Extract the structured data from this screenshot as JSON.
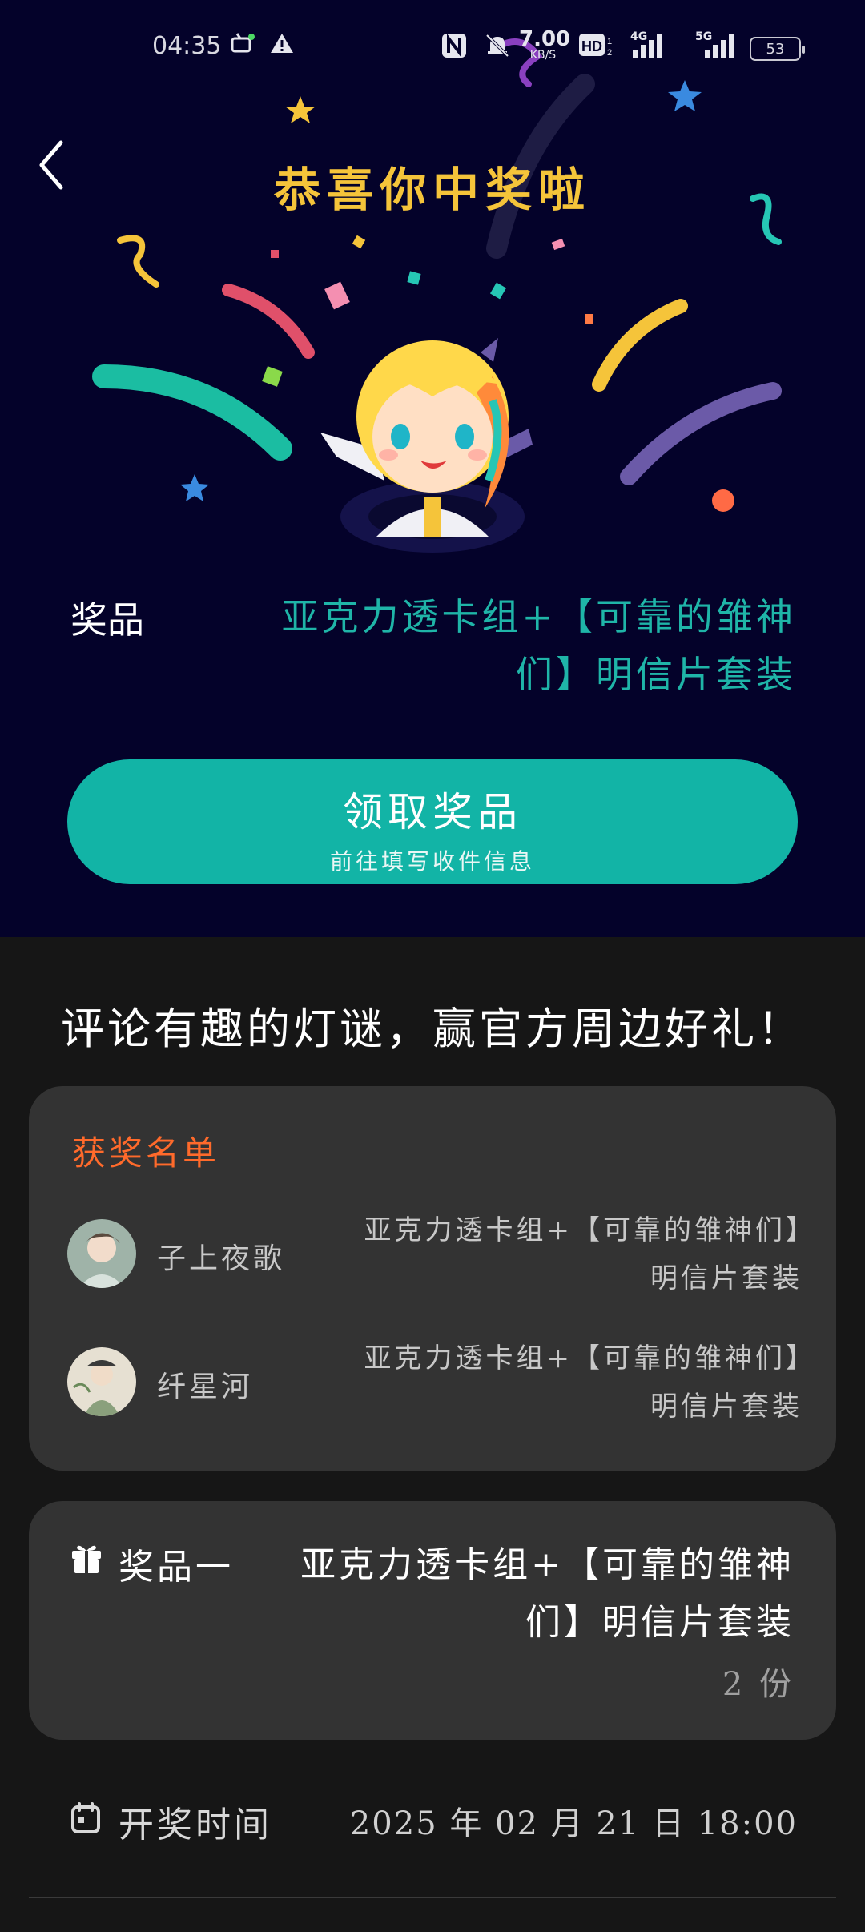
{
  "status_bar": {
    "time": "04:35",
    "speed_value": "7.00",
    "speed_unit": "KB/S",
    "network_1": "4G",
    "network_2": "5G",
    "battery": "53"
  },
  "banner": {
    "title": "恭喜你中奖啦",
    "prize_label": "奖品",
    "prize_name": "亚克力透卡组+【可靠的雏神们】明信片套装",
    "claim_button": {
      "label": "领取奖品",
      "sublabel": "前往填写收件信息"
    }
  },
  "event_title": "评论有趣的灯谜，赢官方周边好礼！",
  "winners": {
    "title": "获奖名单",
    "items": [
      {
        "name": "子上夜歌",
        "prize": "亚克力透卡组+【可靠的雏神们】明信片套装"
      },
      {
        "name": "纤星河",
        "prize": "亚克力透卡组+【可靠的雏神们】明信片套装"
      }
    ]
  },
  "prize_info": {
    "label": "奖品一",
    "name": "亚克力透卡组+【可靠的雏神们】明信片套装",
    "quantity": "2 份"
  },
  "draw": {
    "label": "开奖时间",
    "time": "2025 年 02 月 21 日 18:00"
  },
  "colors": {
    "banner_bg": "#04022a",
    "title_gold": "#f5c43a",
    "teal": "#12b4a6",
    "orange": "#ff6a2b",
    "card_bg": "#333333",
    "page_bg": "#161616"
  }
}
